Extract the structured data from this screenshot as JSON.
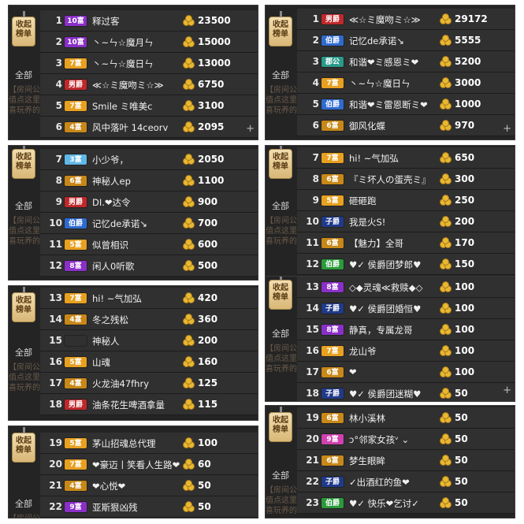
{
  "tag_label": "收起榜单",
  "all_label": "全部",
  "plus_icon": "+",
  "bg_lines": [
    "【房间公告】 一起是缘分，在此是缘分，不要说都惜！充",
    "值点这里",
    "喜玩养的！请来点，所有…努力点，来吧是难免"
  ],
  "colors": {
    "panel": "#242424",
    "row": "#303030",
    "coin": "#e8b832",
    "tag": "#d9b777"
  },
  "panels": [
    {
      "id": "p1",
      "rows": [
        {
          "rank": "1",
          "badge": "10富",
          "badge_color": "purple",
          "name": "释过客",
          "count": "23500"
        },
        {
          "rank": "2",
          "badge": "10富",
          "badge_color": "purple",
          "name": "丶~ㄣ☆魔月ㄣ",
          "count": "15000"
        },
        {
          "rank": "3",
          "badge": "7富",
          "badge_color": "orange",
          "name": "丶~ㄣ☆魔日ㄣ",
          "count": "13000"
        },
        {
          "rank": "4",
          "badge": "男爵",
          "badge_color": "red",
          "name": "≪☆ミ魔吻ミ☆≫",
          "count": "6750"
        },
        {
          "rank": "5",
          "badge": "7富",
          "badge_color": "orange",
          "name": "Smile ミ唯美c",
          "count": "3100"
        },
        {
          "rank": "6",
          "badge": "4富",
          "badge_color": "gold",
          "name": "风中落叶 14ceorv",
          "count": "2095"
        }
      ]
    },
    {
      "id": "p2",
      "rows": [
        {
          "rank": "7",
          "badge": "3富",
          "badge_color": "cyan",
          "name": "小少爷，",
          "count": "2050"
        },
        {
          "rank": "8",
          "badge": "6富",
          "badge_color": "gold",
          "name": "神秘人ep",
          "count": "1100"
        },
        {
          "rank": "9",
          "badge": "男爵",
          "badge_color": "red",
          "name": "DI.❤达令",
          "count": "900"
        },
        {
          "rank": "10",
          "badge": "伯爵",
          "badge_color": "blue",
          "name": "记忆de承诺↘",
          "count": "700"
        },
        {
          "rank": "11",
          "badge": "5富",
          "badge_color": "orange",
          "name": "似曾相识",
          "count": "600"
        },
        {
          "rank": "12",
          "badge": "8富",
          "badge_color": "purple",
          "name": "闲人0听歌",
          "count": "500"
        }
      ]
    },
    {
      "id": "p3",
      "rows": [
        {
          "rank": "13",
          "badge": "7富",
          "badge_color": "orange",
          "name": "hi! ~气加弘",
          "count": "420"
        },
        {
          "rank": "14",
          "badge": "4富",
          "badge_color": "gold",
          "name": "冬之残松",
          "count": "360"
        },
        {
          "rank": "15",
          "badge": "",
          "badge_color": "none",
          "name": "神秘人",
          "count": "200"
        },
        {
          "rank": "16",
          "badge": "5富",
          "badge_color": "orange",
          "name": "山魂",
          "count": "160"
        },
        {
          "rank": "17",
          "badge": "4富",
          "badge_color": "gold",
          "name": "火龙油47fhry",
          "count": "125"
        },
        {
          "rank": "18",
          "badge": "男爵",
          "badge_color": "red",
          "name": "油条花生啤酒拿量",
          "count": "115"
        }
      ]
    },
    {
      "id": "p4",
      "rows": [
        {
          "rank": "19",
          "badge": "5富",
          "badge_color": "orange",
          "name": "茅山招魂总代理",
          "count": "100"
        },
        {
          "rank": "20",
          "badge": "7富",
          "badge_color": "orange",
          "name": "❤豪迈丨笑看人生路❤",
          "count": "60"
        },
        {
          "rank": "21",
          "badge": "4富",
          "badge_color": "gold",
          "name": "❤心悦❤",
          "count": "50"
        },
        {
          "rank": "22",
          "badge": "9富",
          "badge_color": "purple",
          "name": "亚斯狠凶残",
          "count": "50"
        }
      ]
    },
    {
      "id": "p5",
      "rows": [
        {
          "rank": "1",
          "badge": "男爵",
          "badge_color": "red",
          "name": "≪☆ミ魔吻ミ☆≫",
          "count": "29172"
        },
        {
          "rank": "2",
          "badge": "伯爵",
          "badge_color": "blue",
          "name": "记忆de承诺↘",
          "count": "5555"
        },
        {
          "rank": "3",
          "badge": "郡公",
          "badge_color": "teal",
          "name": "和谐❤ミ感恩ミ❤",
          "count": "5200"
        },
        {
          "rank": "4",
          "badge": "7富",
          "badge_color": "orange",
          "name": "丶~ㄣ☆魔日ㄣ",
          "count": "3000"
        },
        {
          "rank": "5",
          "badge": "伯爵",
          "badge_color": "blue",
          "name": "和谐❤ミ雷恩断ミ❤",
          "count": "1000"
        },
        {
          "rank": "6",
          "badge": "6富",
          "badge_color": "gold",
          "name": "御风化蝶",
          "count": "970"
        }
      ]
    },
    {
      "id": "p6",
      "rows": [
        {
          "rank": "7",
          "badge": "7富",
          "badge_color": "orange",
          "name": "hi! ~气加弘",
          "count": "650"
        },
        {
          "rank": "8",
          "badge": "6富",
          "badge_color": "gold",
          "name": "『ミ坏人の蛋壳ミ』",
          "count": "300"
        },
        {
          "rank": "9",
          "badge": "5富",
          "badge_color": "orange",
          "name": "砸砸跑",
          "count": "250"
        },
        {
          "rank": "10",
          "badge": "子爵",
          "badge_color": "navy",
          "name": "我是火S!",
          "count": "200"
        },
        {
          "rank": "11",
          "badge": "6富",
          "badge_color": "gold",
          "name": "【魅力】全哥",
          "count": "170"
        },
        {
          "rank": "12",
          "badge": "伯爵",
          "badge_color": "green",
          "name": "♥✓ 侯爵团梦郎♥",
          "count": "150"
        }
      ]
    },
    {
      "id": "p7",
      "rows": [
        {
          "rank": "13",
          "badge": "8富",
          "badge_color": "purple",
          "name": "◇◆灵魂≪救赎◆◇",
          "count": "100"
        },
        {
          "rank": "14",
          "badge": "子爵",
          "badge_color": "navy",
          "name": "♥✓ 侯爵团婚恒♥",
          "count": "100"
        },
        {
          "rank": "15",
          "badge": "8富",
          "badge_color": "purple",
          "name": "静真，专属龙哥",
          "count": "100"
        },
        {
          "rank": "16",
          "badge": "7富",
          "badge_color": "orange",
          "name": "龙山爷",
          "count": "100"
        },
        {
          "rank": "17",
          "badge": "6富",
          "badge_color": "gold",
          "name": "❤",
          "count": "100"
        },
        {
          "rank": "18",
          "badge": "子爵",
          "badge_color": "navy",
          "name": "♥✓ 侯爵团迷糊♥",
          "count": "50"
        }
      ]
    },
    {
      "id": "p8",
      "rows": [
        {
          "rank": "19",
          "badge": "6富",
          "badge_color": "gold",
          "name": "林小溪林",
          "count": "50"
        },
        {
          "rank": "20",
          "badge": "9富",
          "badge_color": "pink",
          "name": "ɔ°邻家女孩ᵛ ⌄",
          "count": "50"
        },
        {
          "rank": "21",
          "badge": "6富",
          "badge_color": "gold",
          "name": "梦生眼眸",
          "count": "50"
        },
        {
          "rank": "22",
          "badge": "子爵",
          "badge_color": "navy",
          "name": "✓出酒红的鱼❤",
          "count": "50"
        },
        {
          "rank": "23",
          "badge": "伯爵",
          "badge_color": "green",
          "name": "♥✓ 快乐❤乞讨✓",
          "count": "50"
        }
      ]
    }
  ]
}
